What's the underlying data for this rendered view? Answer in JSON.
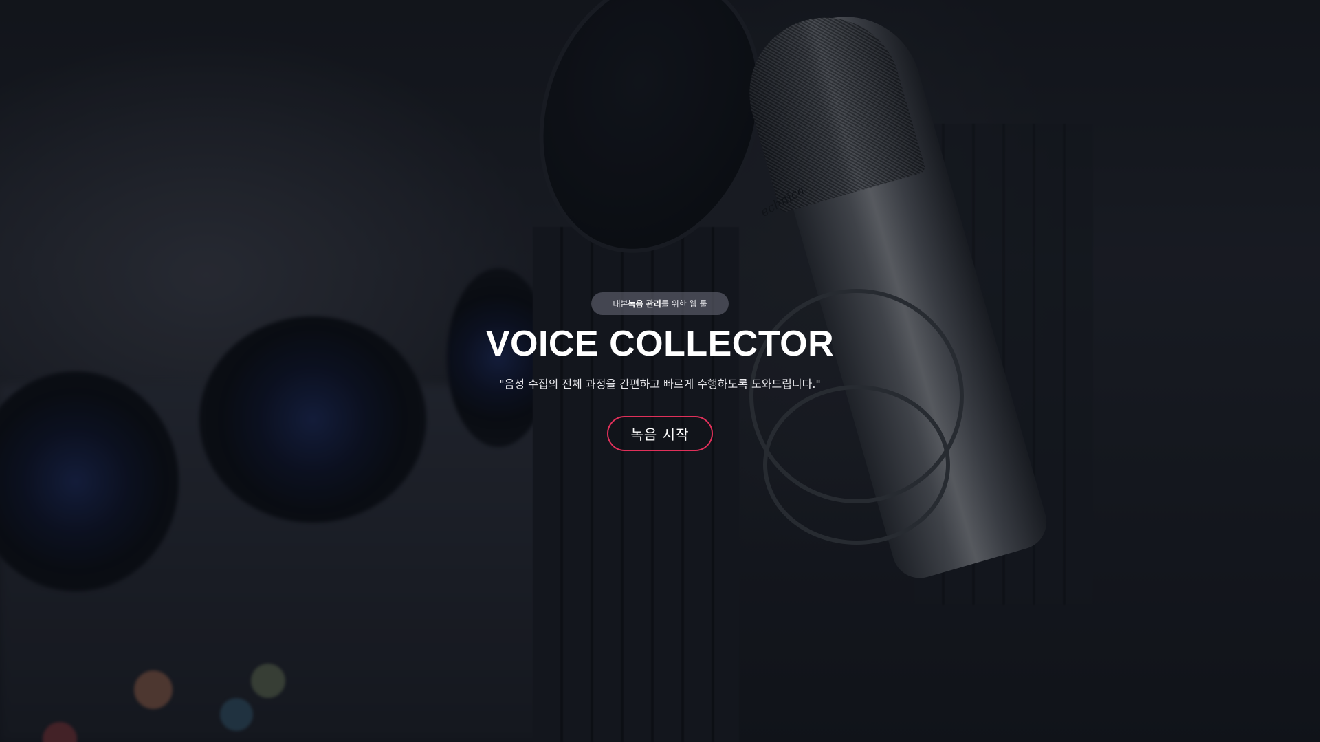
{
  "hero": {
    "tag_pre": "대본 ",
    "tag_bold": "녹음 관리",
    "tag_post": "를 위한 웹 툴",
    "title": "VOICE COLLECTOR",
    "subtitle": "\"음성 수집의 전체 과정을 간편하고 빠르게 수행하도록 도와드립니다.\"",
    "cta_label": "녹음 시작",
    "accent_color": "#e0305a"
  },
  "background": {
    "image": "studio-microphone-photo"
  }
}
